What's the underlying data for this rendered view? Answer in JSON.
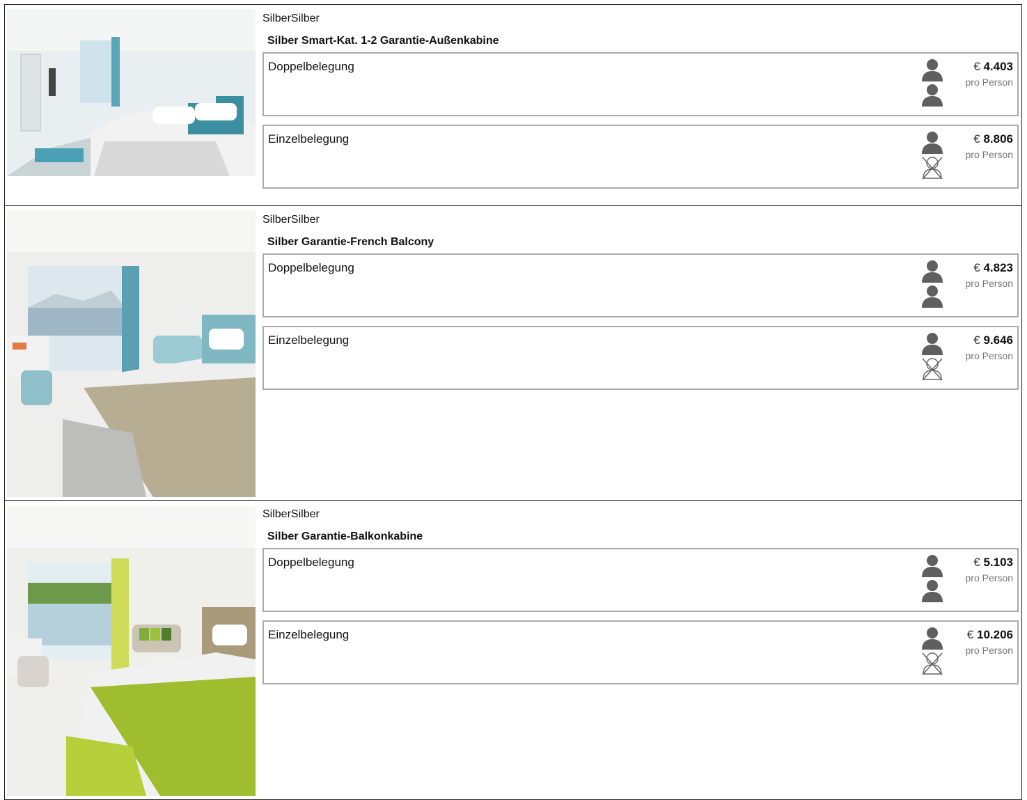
{
  "cabins": [
    {
      "category": "SilberSilber",
      "title": "Silber Smart-Kat. 1-2 Garantie-Außenkabine",
      "options": [
        {
          "label": "Doppelbelegung",
          "currency": "€",
          "price": "4.403",
          "per": "pro Person"
        },
        {
          "label": "Einzelbelegung",
          "currency": "€",
          "price": "8.806",
          "per": "pro Person"
        }
      ]
    },
    {
      "category": "SilberSilber",
      "title": "Silber Garantie-French Balcony",
      "options": [
        {
          "label": "Doppelbelegung",
          "currency": "€",
          "price": "4.823",
          "per": "pro Person"
        },
        {
          "label": "Einzelbelegung",
          "currency": "€",
          "price": "9.646",
          "per": "pro Person"
        }
      ]
    },
    {
      "category": "SilberSilber",
      "title": "Silber Garantie-Balkonkabine",
      "options": [
        {
          "label": "Doppelbelegung",
          "currency": "€",
          "price": "5.103",
          "per": "pro Person"
        },
        {
          "label": "Einzelbelegung",
          "currency": "€",
          "price": "10.206",
          "per": "pro Person"
        }
      ]
    }
  ],
  "icons": {
    "occupied": "person-icon",
    "unoccupied": "person-crossed-icon"
  },
  "colors": {
    "person_icon": "#5f5f5f",
    "border": "#aaaaaa",
    "accent_blue": "#5aa6b8",
    "accent_green": "#9cc23a"
  }
}
